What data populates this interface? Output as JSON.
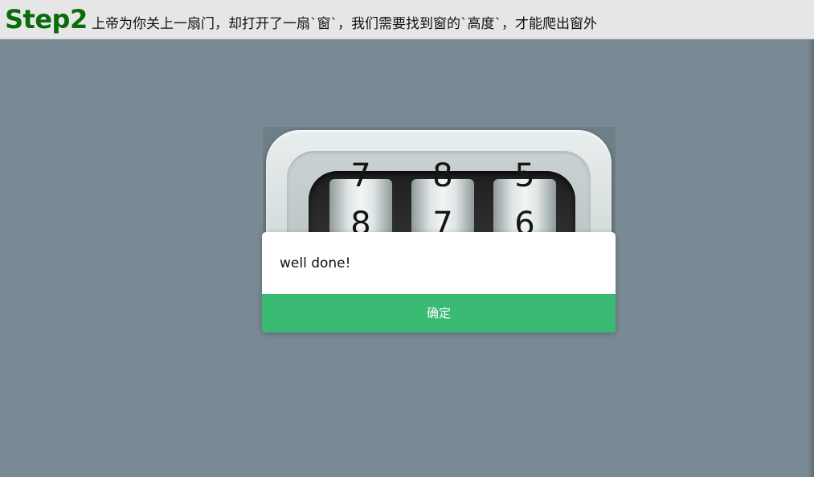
{
  "header": {
    "step_title": "Step2",
    "description": "上帝为你关上一扇门，却打开了一扇`窗`，我们需要找到窗的`高度`，才能爬出窗外"
  },
  "lock": {
    "wheels": [
      {
        "prev": "7",
        "current": "8"
      },
      {
        "prev": "8",
        "current": "7"
      },
      {
        "prev": "5",
        "current": "6"
      }
    ]
  },
  "dialog": {
    "message": "well done!",
    "confirm_label": "确定"
  },
  "colors": {
    "header_bg": "#e6e6e6",
    "title": "#0b6b0b",
    "stage_bg": "#7a8a94",
    "confirm_bg": "#3ab973"
  }
}
